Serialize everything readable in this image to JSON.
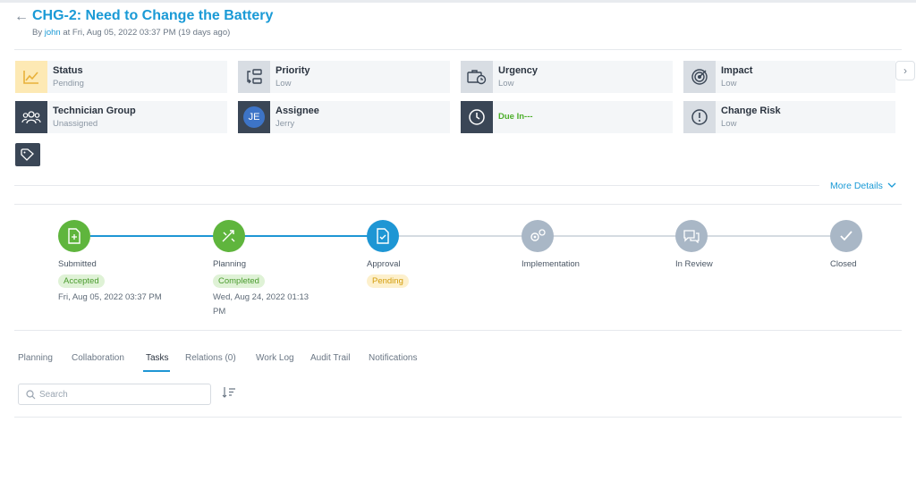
{
  "header": {
    "back_icon": "←",
    "title": "CHG-2: Need to Change the Battery",
    "by_prefix": "By ",
    "user": "john",
    "by_suffix": " at Fri, Aug 05, 2022 03:37 PM (19 days ago)"
  },
  "cards": [
    {
      "label": "Status",
      "value": "Pending",
      "icon": "chart-line-icon"
    },
    {
      "label": "Priority",
      "value": "Low",
      "icon": "priority-icon"
    },
    {
      "label": "Urgency",
      "value": "Low",
      "icon": "briefcase-clock-icon"
    },
    {
      "label": "Impact",
      "value": "Low",
      "icon": "target-icon"
    },
    {
      "label": "Technician Group",
      "value": "Unassigned",
      "icon": "group-icon"
    },
    {
      "label": "Assignee",
      "value": "Jerry",
      "avatar": "JE"
    },
    {
      "label": "Due In---",
      "icon": "clock-icon"
    },
    {
      "label": "Change Risk",
      "value": "Low",
      "icon": "alert-circle-icon"
    }
  ],
  "next_arrow": "›",
  "more_details": "More Details",
  "steps": [
    {
      "name": "Submitted",
      "badge": "Accepted",
      "date": "Fri, Aug 05, 2022 03:37 PM"
    },
    {
      "name": "Planning",
      "badge": "Completed",
      "date": "Wed, Aug 24, 2022 01:13 PM"
    },
    {
      "name": "Approval",
      "badge": "Pending"
    },
    {
      "name": "Implementation"
    },
    {
      "name": "In Review"
    },
    {
      "name": "Closed"
    }
  ],
  "tabs": [
    "Planning",
    "Collaboration",
    "Tasks",
    "Relations (0)",
    "Work Log",
    "Audit Trail",
    "Notifications"
  ],
  "active_tab": "Tasks",
  "search": {
    "placeholder": "Search"
  },
  "colors": {
    "accent": "#1a9ad6",
    "green": "#5fb53d",
    "step_grey": "#a9b7c6",
    "dark_icon": "#3a4656"
  }
}
